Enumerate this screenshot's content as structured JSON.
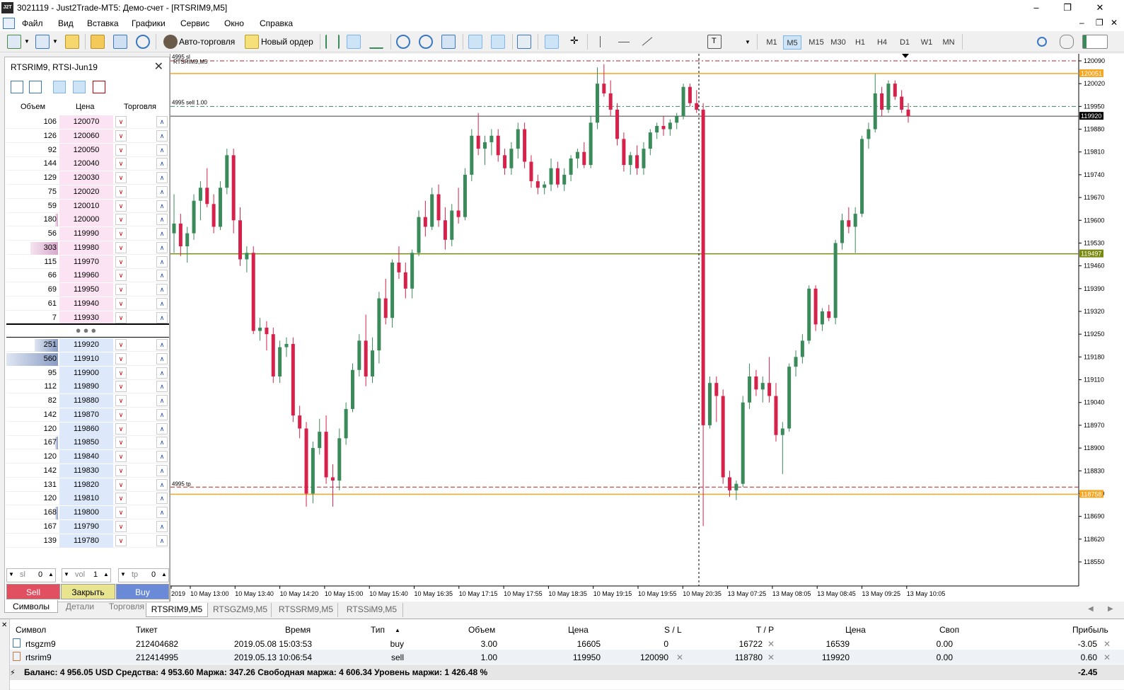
{
  "window": {
    "title": "3021119 - Just2Trade-MT5: Демо-счет - [RTSRIM9,M5]",
    "logo": "J2T"
  },
  "menu": [
    "Файл",
    "Вид",
    "Вставка",
    "Графики",
    "Сервис",
    "Окно",
    "Справка"
  ],
  "toolbar": {
    "autotrade_label": "Авто-торговля",
    "new_order_label": "Новый ордер",
    "timeframes": [
      "M1",
      "M5",
      "M15",
      "M30",
      "H1",
      "H4",
      "D1",
      "W1",
      "MN"
    ],
    "active_timeframe": "M5"
  },
  "depth": {
    "title": "RTSRIM9, RTSI-Jun19",
    "col_volume": "Объем",
    "col_price": "Цена",
    "col_trade": "Торговля",
    "asks": [
      {
        "vol": "106",
        "price": "120070",
        "bar": 0
      },
      {
        "vol": "126",
        "price": "120060",
        "bar": 0
      },
      {
        "vol": "92",
        "price": "120050",
        "bar": 0
      },
      {
        "vol": "144",
        "price": "120040",
        "bar": 0
      },
      {
        "vol": "129",
        "price": "120030",
        "bar": 0
      },
      {
        "vol": "75",
        "price": "120020",
        "bar": 0
      },
      {
        "vol": "59",
        "price": "120010",
        "bar": 0
      },
      {
        "vol": "180",
        "price": "120000",
        "bar": 0.05
      },
      {
        "vol": "56",
        "price": "119990",
        "bar": 0
      },
      {
        "vol": "303",
        "price": "119980",
        "bar": 0.54
      },
      {
        "vol": "115",
        "price": "119970",
        "bar": 0
      },
      {
        "vol": "66",
        "price": "119960",
        "bar": 0
      },
      {
        "vol": "69",
        "price": "119950",
        "bar": 0
      },
      {
        "vol": "61",
        "price": "119940",
        "bar": 0
      },
      {
        "vol": "7",
        "price": "119930",
        "bar": 0
      }
    ],
    "bids": [
      {
        "vol": "251",
        "price": "119920",
        "bar": 0.45
      },
      {
        "vol": "560",
        "price": "119910",
        "bar": 1.0
      },
      {
        "vol": "95",
        "price": "119900",
        "bar": 0
      },
      {
        "vol": "112",
        "price": "119890",
        "bar": 0
      },
      {
        "vol": "82",
        "price": "119880",
        "bar": 0
      },
      {
        "vol": "142",
        "price": "119870",
        "bar": 0
      },
      {
        "vol": "120",
        "price": "119860",
        "bar": 0
      },
      {
        "vol": "167",
        "price": "119850",
        "bar": 0.05
      },
      {
        "vol": "120",
        "price": "119840",
        "bar": 0
      },
      {
        "vol": "142",
        "price": "119830",
        "bar": 0
      },
      {
        "vol": "131",
        "price": "119820",
        "bar": 0
      },
      {
        "vol": "120",
        "price": "119810",
        "bar": 0
      },
      {
        "vol": "168",
        "price": "119800",
        "bar": 0.05
      },
      {
        "vol": "167",
        "price": "119790",
        "bar": 0
      },
      {
        "vol": "139",
        "price": "119780",
        "bar": 0
      }
    ],
    "sl_label": "sl",
    "sl_value": "0",
    "vol_label": "vol",
    "vol_value": "1",
    "tp_label": "tp",
    "tp_value": "0",
    "sell_label": "Sell",
    "close_label": "Закрыть",
    "buy_label": "Buy"
  },
  "side_tabs": [
    "Символы",
    "Детали",
    "Торговля"
  ],
  "chart_tabs": [
    "RTSRIM9,M5",
    "RTSGZM9,M5",
    "RTSSRM9,M5",
    "RTSSiM9,M5"
  ],
  "chart": {
    "symbol_label": "RTSRIM9,M5",
    "sl_line_label": "4995 sl",
    "sell_line_label": "4995 sell 1.00",
    "tp_line_label": "4995 tp",
    "price_labels": [
      "120090",
      "120020",
      "119950",
      "119880",
      "119810",
      "119740",
      "119670",
      "119600",
      "119530",
      "119460",
      "119390",
      "119320",
      "119250",
      "119180",
      "119110",
      "119040",
      "118970",
      "118900",
      "118830",
      "118760",
      "118690",
      "118620",
      "118550"
    ],
    "tagged_prices": {
      "orange_top": "120051",
      "current": "119920",
      "olive": "119497",
      "orange_bottom": "118758"
    },
    "time_labels": [
      "2019",
      "10 May 13:00",
      "10 May 13:40",
      "10 May 14:20",
      "10 May 15:00",
      "10 May 15:40",
      "10 May 16:35",
      "10 May 17:15",
      "10 May 17:55",
      "10 May 18:35",
      "10 May 19:15",
      "10 May 19:55",
      "10 May 20:35",
      "13 May 07:25",
      "13 May 08:05",
      "13 May 08:45",
      "13 May 09:25",
      "13 May 10:05"
    ],
    "colors": {
      "up": "#3a8a5a",
      "down": "#d6224a",
      "sl": "#c0202a",
      "orange": "#f5a623",
      "olive": "#7a8a10",
      "tp": "#c0202a",
      "sell": "#3a8a5a"
    }
  },
  "chart_data": {
    "type": "candlestick",
    "ylim": [
      118500,
      120110
    ],
    "candles": [
      [
        119560,
        119680,
        119500,
        119590
      ],
      [
        119590,
        119620,
        119490,
        119520
      ],
      [
        119520,
        119580,
        119470,
        119560
      ],
      [
        119560,
        119680,
        119540,
        119660
      ],
      [
        119660,
        119720,
        119600,
        119700
      ],
      [
        119700,
        119760,
        119640,
        119650
      ],
      [
        119650,
        119680,
        119560,
        119580
      ],
      [
        119580,
        119720,
        119570,
        119700
      ],
      [
        119700,
        119820,
        119680,
        119800
      ],
      [
        119800,
        119820,
        119560,
        119600
      ],
      [
        119600,
        119640,
        119460,
        119480
      ],
      [
        119480,
        119520,
        119440,
        119500
      ],
      [
        119500,
        119520,
        119250,
        119260
      ],
      [
        119260,
        119300,
        119230,
        119270
      ],
      [
        119270,
        119290,
        119200,
        119250
      ],
      [
        119250,
        119270,
        119100,
        119120
      ],
      [
        119120,
        119230,
        119100,
        119210
      ],
      [
        119210,
        119240,
        119180,
        119220
      ],
      [
        119220,
        119240,
        118980,
        119000
      ],
      [
        119000,
        119030,
        118930,
        118960
      ],
      [
        118960,
        118980,
        118720,
        118760
      ],
      [
        118760,
        118920,
        118730,
        118900
      ],
      [
        118900,
        118990,
        118880,
        118950
      ],
      [
        118950,
        119000,
        118790,
        118810
      ],
      [
        118810,
        118850,
        118720,
        118800
      ],
      [
        118800,
        118960,
        118770,
        118930
      ],
      [
        118930,
        119040,
        118910,
        119020
      ],
      [
        119020,
        119160,
        119010,
        119140
      ],
      [
        119140,
        119250,
        119120,
        119230
      ],
      [
        119230,
        119310,
        119090,
        119120
      ],
      [
        119120,
        119240,
        119100,
        119200
      ],
      [
        119200,
        119380,
        119160,
        119360
      ],
      [
        119360,
        119420,
        119280,
        119300
      ],
      [
        119300,
        119480,
        119270,
        119470
      ],
      [
        119470,
        119520,
        119420,
        119440
      ],
      [
        119440,
        119470,
        119360,
        119390
      ],
      [
        119390,
        119510,
        119360,
        119500
      ],
      [
        119500,
        119630,
        119490,
        119610
      ],
      [
        119610,
        119660,
        119550,
        119580
      ],
      [
        119580,
        119700,
        119570,
        119680
      ],
      [
        119680,
        119710,
        119580,
        119600
      ],
      [
        119600,
        119640,
        119510,
        119540
      ],
      [
        119540,
        119650,
        119520,
        119630
      ],
      [
        119630,
        119700,
        119590,
        119610
      ],
      [
        119610,
        119760,
        119600,
        119740
      ],
      [
        119740,
        119880,
        119720,
        119860
      ],
      [
        119860,
        119930,
        119800,
        119820
      ],
      [
        119820,
        119860,
        119770,
        119840
      ],
      [
        119840,
        119880,
        119800,
        119860
      ],
      [
        119860,
        119880,
        119780,
        119800
      ],
      [
        119800,
        119820,
        119740,
        119760
      ],
      [
        119760,
        119840,
        119740,
        119820
      ],
      [
        119820,
        119900,
        119790,
        119880
      ],
      [
        119880,
        119900,
        119760,
        119780
      ],
      [
        119780,
        119800,
        119700,
        119720
      ],
      [
        119720,
        119740,
        119680,
        119700
      ],
      [
        119700,
        119720,
        119680,
        119710
      ],
      [
        119710,
        119790,
        119690,
        119760
      ],
      [
        119760,
        119780,
        119700,
        119710
      ],
      [
        119710,
        119760,
        119690,
        119740
      ],
      [
        119740,
        119800,
        119720,
        119790
      ],
      [
        119790,
        119820,
        119760,
        119810
      ],
      [
        119810,
        119840,
        119760,
        119770
      ],
      [
        119770,
        119920,
        119760,
        119900
      ],
      [
        119900,
        120070,
        119880,
        120020
      ],
      [
        120020,
        120080,
        119980,
        119990
      ],
      [
        119990,
        120030,
        119920,
        119940
      ],
      [
        119940,
        119960,
        119830,
        119850
      ],
      [
        119850,
        119870,
        119750,
        119770
      ],
      [
        119770,
        119810,
        119740,
        119800
      ],
      [
        119800,
        119830,
        119740,
        119760
      ],
      [
        119760,
        119840,
        119740,
        119820
      ],
      [
        119820,
        119880,
        119800,
        119870
      ],
      [
        119870,
        119900,
        119850,
        119890
      ],
      [
        119890,
        119920,
        119860,
        119880
      ],
      [
        119880,
        119910,
        119860,
        119900
      ],
      [
        119900,
        119930,
        119880,
        119920
      ],
      [
        119920,
        120020,
        119910,
        120010
      ],
      [
        120010,
        120020,
        119950,
        119960
      ],
      [
        119960,
        120000,
        119930,
        119940
      ],
      [
        119940,
        119960,
        118660,
        118970
      ],
      [
        118970,
        119120,
        118960,
        119100
      ],
      [
        119100,
        119120,
        118980,
        119060
      ],
      [
        119060,
        119080,
        118790,
        118810
      ],
      [
        118810,
        118830,
        118750,
        118770
      ],
      [
        118770,
        118800,
        118740,
        118790
      ],
      [
        118790,
        119060,
        118780,
        119040
      ],
      [
        119040,
        119160,
        119020,
        119120
      ],
      [
        119120,
        119140,
        119060,
        119080
      ],
      [
        119080,
        119120,
        119040,
        119100
      ],
      [
        119100,
        119180,
        119040,
        119060
      ],
      [
        119060,
        119100,
        118920,
        118940
      ],
      [
        118940,
        118980,
        118820,
        118960
      ],
      [
        118960,
        119160,
        118950,
        119150
      ],
      [
        119150,
        119200,
        119120,
        119180
      ],
      [
        119180,
        119250,
        119160,
        119230
      ],
      [
        119230,
        119400,
        119220,
        119390
      ],
      [
        119390,
        119400,
        119260,
        119280
      ],
      [
        119280,
        119330,
        119260,
        119320
      ],
      [
        119320,
        119340,
        119290,
        119300
      ],
      [
        119300,
        119540,
        119280,
        119530
      ],
      [
        119530,
        119620,
        119510,
        119600
      ],
      [
        119600,
        119640,
        119560,
        119580
      ],
      [
        119580,
        119640,
        119500,
        119620
      ],
      [
        119620,
        119860,
        119610,
        119850
      ],
      [
        119850,
        119900,
        119820,
        119880
      ],
      [
        119880,
        120050,
        119870,
        119990
      ],
      [
        119990,
        120010,
        119920,
        119940
      ],
      [
        119940,
        120030,
        119930,
        120020
      ],
      [
        120020,
        120030,
        119970,
        119980
      ],
      [
        119980,
        120000,
        119930,
        119940
      ],
      [
        119940,
        119960,
        119900,
        119920
      ]
    ]
  },
  "terminal": {
    "headers": [
      "Символ",
      "Тикет",
      "Время",
      "Тип",
      "Объем",
      "Цена",
      "S / L",
      "T / P",
      "Цена",
      "Своп",
      "Прибыль"
    ],
    "rows": [
      {
        "symbol": "rtsgzm9",
        "ticket": "212404682",
        "time": "2019.05.08 15:03:53",
        "type": "buy",
        "volume": "3.00",
        "price": "16605",
        "sl": "0",
        "tp": "16722",
        "cur": "16539",
        "swap": "0.00",
        "profit": "-3.05"
      },
      {
        "symbol": "rtsrim9",
        "ticket": "212414995",
        "time": "2019.05.13 10:06:54",
        "type": "sell",
        "volume": "1.00",
        "price": "119950",
        "sl": "120090",
        "tp": "118780",
        "cur": "119920",
        "swap": "0.00",
        "profit": "0.60"
      }
    ],
    "balance_text": "Баланс: 4 956.05 USD  Средства: 4 953.60  Маржа: 347.26  Свободная маржа: 4 606.34  Уровень маржи: 1 426.48 %",
    "total_profit": "-2.45"
  }
}
